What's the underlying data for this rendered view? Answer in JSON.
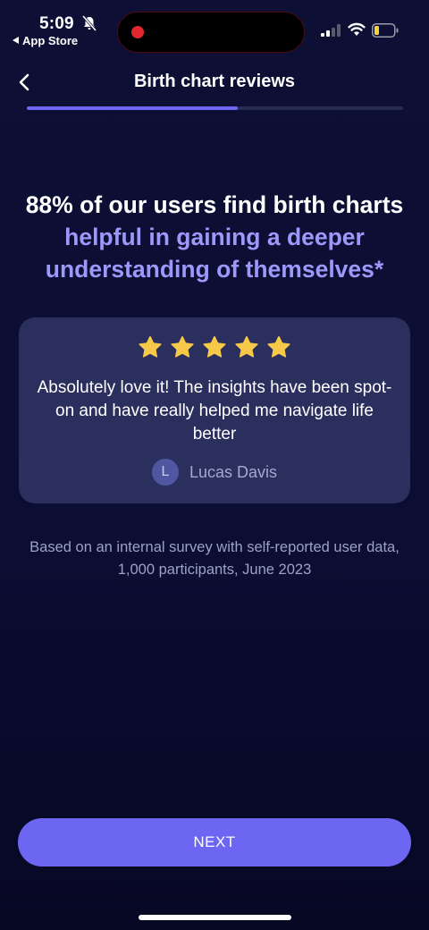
{
  "status_bar": {
    "time": "5:09",
    "back_app": "App Store"
  },
  "header": {
    "title": "Birth chart reviews",
    "progress": 0.56
  },
  "headline": {
    "part1": "88% of our users find birth charts ",
    "accent": "helpful in gaining a deeper understanding of themselves*"
  },
  "review": {
    "stars": 5,
    "text": "Absolutely love it! The insights have been spot-on and have really helped me navigate life better",
    "author_initial": "L",
    "author_name": "Lucas Davis"
  },
  "disclaimer": "Based on an internal survey with self-reported user data, 1,000 participants, June 2023",
  "next_button": "NEXT",
  "colors": {
    "accent": "#6c66f3",
    "accent_text": "#9e98fb",
    "star": "#f7c948",
    "card": "#2b2f5d",
    "recording": "#e0262f",
    "battery_low": "#f5d33a"
  }
}
